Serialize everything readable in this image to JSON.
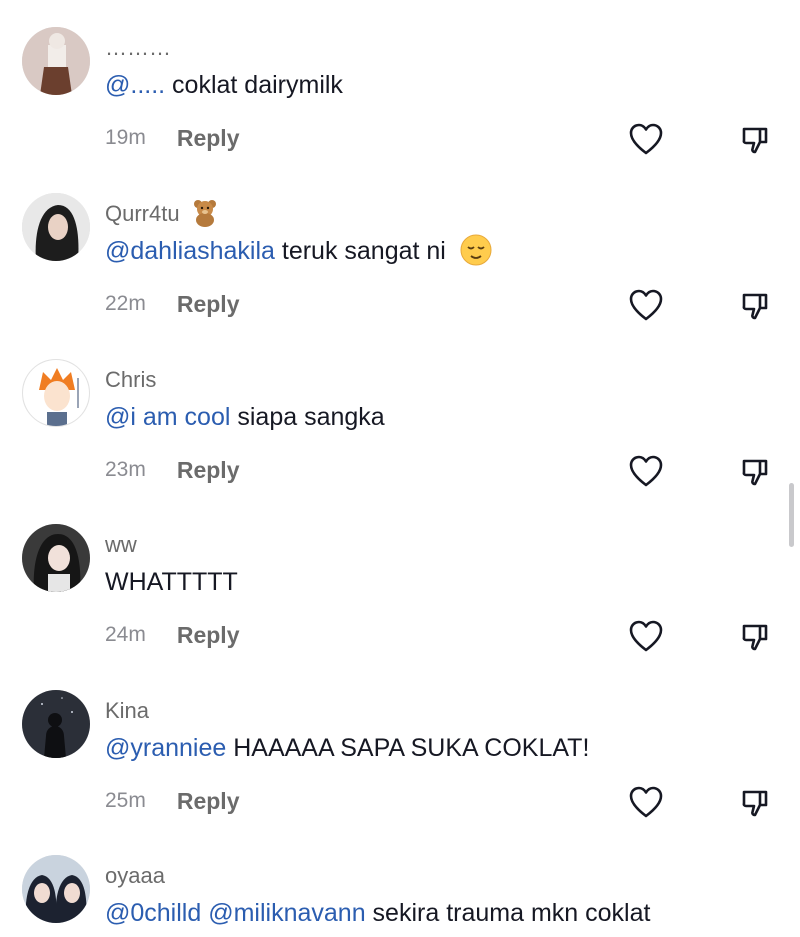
{
  "comments": [
    {
      "username": "………",
      "mention1": "@.....",
      "mention2": "",
      "text": " coklat dairymilk",
      "time": "19m",
      "reply": "Reply",
      "emoji": ""
    },
    {
      "username": "Qurr4tu",
      "mention1": "@dahliashakila",
      "mention2": "",
      "text": " teruk sangat ni",
      "time": "22m",
      "reply": "Reply",
      "emoji": "relieved-face"
    },
    {
      "username": "Chris",
      "mention1": "@i am cool",
      "mention2": "",
      "text": " siapa sangka",
      "time": "23m",
      "reply": "Reply",
      "emoji": ""
    },
    {
      "username": "ww",
      "mention1": "",
      "mention2": "",
      "text": "WHATTTTT",
      "time": "24m",
      "reply": "Reply",
      "emoji": ""
    },
    {
      "username": "Kina",
      "mention1": "@yranniee",
      "mention2": "",
      "text": " HAAAAA SAPA SUKA COKLAT!",
      "time": "25m",
      "reply": "Reply",
      "emoji": ""
    },
    {
      "username": "oyaaa",
      "mention1": "@0chilld",
      "mention2": " @miliknavann",
      "text": " sekira trauma mkn coklat",
      "time": "",
      "reply": "",
      "emoji": ""
    }
  ],
  "icons": {
    "like": "heart-outline-icon",
    "dislike": "thumbs-down-icon",
    "username_badge": "teddy-bear-emoji"
  },
  "colors": {
    "mention": "#2b5db0",
    "text": "#161823",
    "muted": "#8a8b91"
  }
}
